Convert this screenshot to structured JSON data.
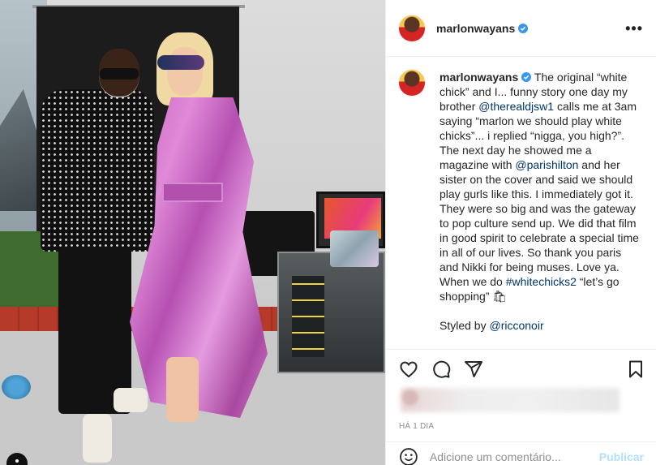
{
  "post": {
    "username": "marlonwayans",
    "more_icon": "more-horizontal-icon",
    "colors": {
      "verified": "#3897f0",
      "mention": "#00376b",
      "publish": "#b2dffc",
      "meta": "#8e8e8e"
    }
  },
  "caption": {
    "username": "marlonwayans",
    "text_1": " The original “white chick” and I... funny story one day my brother ",
    "mention_1": "@therealdjsw1",
    "text_2": " calls me at 3am saying “marlon we should play white chicks”... i replied “nigga, you high?”. The next day he showed me a magazine with ",
    "mention_2": "@parishilton",
    "text_3": " and her sister on the cover and said we should play gurls like this. I immediately got it. They were so big and was the gateway to pop culture send up. We did that film in good spirit to celebrate a special time in all of our lives. So thank you paris and Nikki for being muses. Love ya. When we do ",
    "hashtag": "#whitechicks2",
    "text_4": " “let’s go shopping” 🛍",
    "styled_prefix": "Styled by ",
    "styled_mention": "@ricconoir"
  },
  "actions": {
    "like_icon": "heart-icon",
    "comment_icon": "comment-icon",
    "share_icon": "send-icon",
    "save_icon": "bookmark-icon"
  },
  "meta": {
    "time": "HÁ 1 DIA"
  },
  "comment": {
    "placeholder": "Adicione um comentário...",
    "publish_label": "Publicar",
    "emoji_icon": "emoji-icon"
  }
}
